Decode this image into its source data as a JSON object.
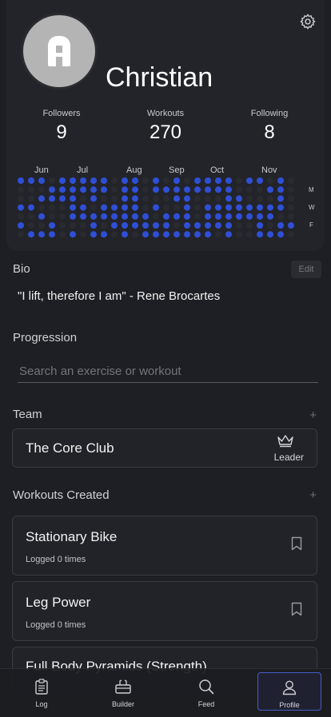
{
  "profile": {
    "name": "Christian"
  },
  "stats": [
    {
      "label": "Followers",
      "value": "9"
    },
    {
      "label": "Workouts",
      "value": "270"
    },
    {
      "label": "Following",
      "value": "8"
    }
  ],
  "activity": {
    "months": [
      "Jun",
      "Jul",
      "Aug",
      "Sep",
      "Oct",
      "Nov"
    ],
    "day_labels": [
      "M",
      "W",
      "F"
    ],
    "active_color": "#2f4fd6",
    "inactive_color": "#2a2b30"
  },
  "bio": {
    "title": "Bio",
    "edit_label": "Edit",
    "text": "\"I lift, therefore I am\" - Rene Brocartes"
  },
  "progression": {
    "title": "Progression",
    "search_placeholder": "Search an exercise or workout"
  },
  "team": {
    "title": "Team",
    "add_label": "+",
    "name": "The Core Club",
    "role": "Leader"
  },
  "workouts_created": {
    "title": "Workouts Created",
    "add_label": "+",
    "items": [
      {
        "name": "Stationary Bike",
        "logged": "Logged 0 times"
      },
      {
        "name": "Leg Power",
        "logged": "Logged 0 times"
      },
      {
        "name": "Full Body Pyramids (Strength)",
        "logged": ""
      }
    ]
  },
  "tabs": [
    {
      "label": "Log",
      "icon": "clipboard-icon"
    },
    {
      "label": "Builder",
      "icon": "toolbox-icon"
    },
    {
      "label": "Feed",
      "icon": "magnifier-icon"
    },
    {
      "label": "Profile",
      "icon": "person-icon",
      "active": true
    }
  ]
}
